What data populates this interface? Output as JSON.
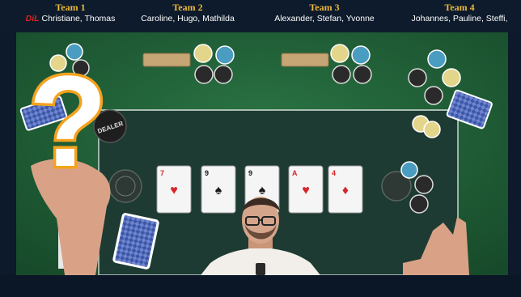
{
  "teams": [
    {
      "title": "Team 1",
      "badge": "DiL",
      "members": "Christiane, Thomas"
    },
    {
      "title": "Team 2",
      "members": "Caroline, Hugo, Mathilda"
    },
    {
      "title": "Team 3",
      "members": "Alexander, Stefan, Yvonne"
    },
    {
      "title": "Team 4",
      "members": "Johannes, Pauline, Steffi,"
    }
  ],
  "dealer_button": {
    "label": "DEALER"
  },
  "board_cards": [
    {
      "rank": "7",
      "suit": "hearts",
      "color": "#d6262b"
    },
    {
      "rank": "9",
      "suit": "spades",
      "color": "#1a1a1a"
    },
    {
      "rank": "9",
      "suit": "spades",
      "color": "#1a1a1a"
    },
    {
      "rank": "A",
      "suit": "hearts",
      "color": "#d6262b"
    },
    {
      "rank": "4",
      "suit": "diamonds",
      "color": "#d6262b"
    }
  ],
  "overlay": {
    "symbol": "?"
  },
  "colors": {
    "felt": "#1f5e34",
    "felt_dark": "#1d3b33",
    "header_bg": "#0d1b2c",
    "team_title": "#f0b93a",
    "question_mark": "#f4a21e"
  }
}
